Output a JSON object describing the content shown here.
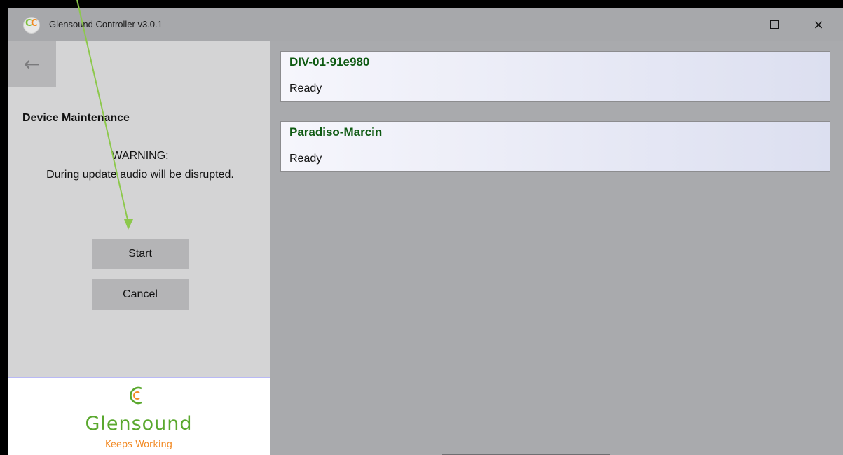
{
  "window": {
    "title": "Glensound Controller v3.0.1",
    "icon": "glensound-app-icon",
    "controls": {
      "minimize": "minimize-icon",
      "maximize": "maximize-icon",
      "close": "×"
    }
  },
  "left_panel": {
    "back_icon": "←",
    "page_title": "Device Maintenance",
    "warning_title": "WARNING:",
    "warning_text": "During update audio will be disrupted.",
    "start_label": "Start",
    "cancel_label": "Cancel"
  },
  "logo": {
    "name": "Glensound",
    "tagline": "Keeps Working",
    "colors": {
      "primary": "#5aa82e",
      "accent": "#f28a24"
    }
  },
  "devices": [
    {
      "name": "DIV-01-91e980",
      "status": "Ready"
    },
    {
      "name": "Paradiso-Marcin",
      "status": "Ready"
    }
  ],
  "colors": {
    "window_bg": "#a9aaad",
    "panel_bg": "#d4d4d5",
    "button_bg": "#b4b4b6",
    "device_name": "#0e5a12",
    "annotation_arrow": "#8cc84b"
  }
}
